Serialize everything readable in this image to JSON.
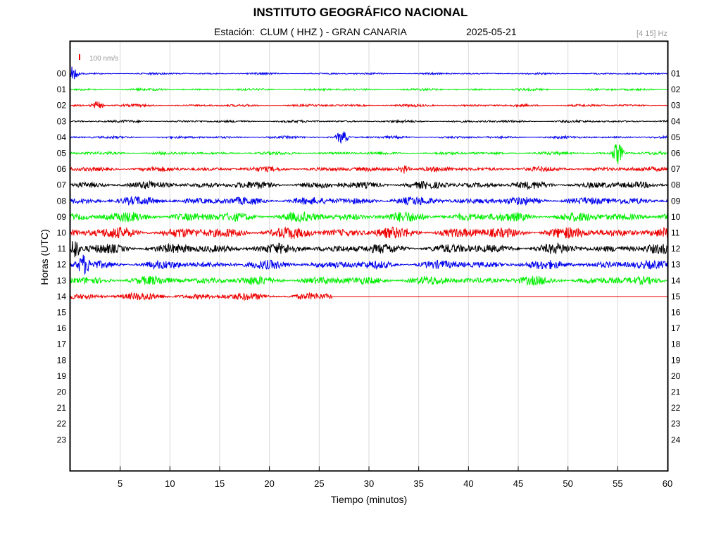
{
  "header": {
    "title": "INSTITUTO GEOGRÁFICO NACIONAL",
    "station": "Estación:  CLUM ( HHZ ) - GRAN CANARIA",
    "date": "2025-05-21",
    "filter": "[4 15] Hz"
  },
  "colors": {
    "trace_cycle": [
      "#0000ee",
      "#00ee00",
      "#ee0000",
      "#000000"
    ],
    "grid": "#d9d9d9",
    "axes": "#000000",
    "scale_bar": "#ee0000",
    "muted_text": "#999999"
  },
  "chart_data": {
    "type": "line",
    "title": "INSTITUTO GEOGRÁFICO NACIONAL",
    "xlabel": "Tiempo (minutos)",
    "ylabel": "Horas (UTC)",
    "xlim": [
      0,
      60
    ],
    "xticks": [
      5,
      10,
      15,
      20,
      25,
      30,
      35,
      40,
      45,
      50,
      55,
      60
    ],
    "grid": true,
    "scale_label": "100 nm/s",
    "left_hour_labels": [
      "00",
      "01",
      "02",
      "03",
      "04",
      "05",
      "06",
      "07",
      "08",
      "09",
      "10",
      "11",
      "12",
      "13",
      "14",
      "15",
      "16",
      "17",
      "18",
      "19",
      "20",
      "21",
      "22",
      "23"
    ],
    "right_hour_labels": [
      "01",
      "02",
      "03",
      "04",
      "05",
      "06",
      "07",
      "08",
      "09",
      "10",
      "11",
      "12",
      "13",
      "14",
      "15",
      "16",
      "17",
      "18",
      "19",
      "20",
      "21",
      "22",
      "23",
      "24"
    ],
    "series": [
      {
        "hour": 0,
        "amplitude": 1.5,
        "end_minute": 60
      },
      {
        "hour": 1,
        "amplitude": 1.8,
        "end_minute": 60
      },
      {
        "hour": 2,
        "amplitude": 2.0,
        "end_minute": 60
      },
      {
        "hour": 3,
        "amplitude": 2.0,
        "end_minute": 60
      },
      {
        "hour": 4,
        "amplitude": 2.0,
        "end_minute": 60
      },
      {
        "hour": 5,
        "amplitude": 2.5,
        "end_minute": 60
      },
      {
        "hour": 6,
        "amplitude": 4.0,
        "end_minute": 60
      },
      {
        "hour": 7,
        "amplitude": 6.0,
        "end_minute": 60
      },
      {
        "hour": 8,
        "amplitude": 6.5,
        "end_minute": 60
      },
      {
        "hour": 9,
        "amplitude": 8.0,
        "end_minute": 60
      },
      {
        "hour": 10,
        "amplitude": 9.0,
        "end_minute": 60
      },
      {
        "hour": 11,
        "amplitude": 8.0,
        "end_minute": 60
      },
      {
        "hour": 12,
        "amplitude": 7.0,
        "end_minute": 60
      },
      {
        "hour": 13,
        "amplitude": 7.0,
        "end_minute": 60
      },
      {
        "hour": 14,
        "amplitude": 6.0,
        "end_minute": 26.3
      }
    ],
    "events": [
      {
        "hour": 0,
        "minute": 0.2,
        "amplitude": 10
      },
      {
        "hour": 2,
        "minute": 2.7,
        "amplitude": 6
      },
      {
        "hour": 4,
        "minute": 27.3,
        "amplitude": 10
      },
      {
        "hour": 5,
        "minute": 55.0,
        "amplitude": 16
      },
      {
        "hour": 6,
        "minute": 33.5,
        "amplitude": 7
      },
      {
        "hour": 11,
        "minute": 0.3,
        "amplitude": 14
      },
      {
        "hour": 12,
        "minute": 1.3,
        "amplitude": 12
      }
    ]
  }
}
